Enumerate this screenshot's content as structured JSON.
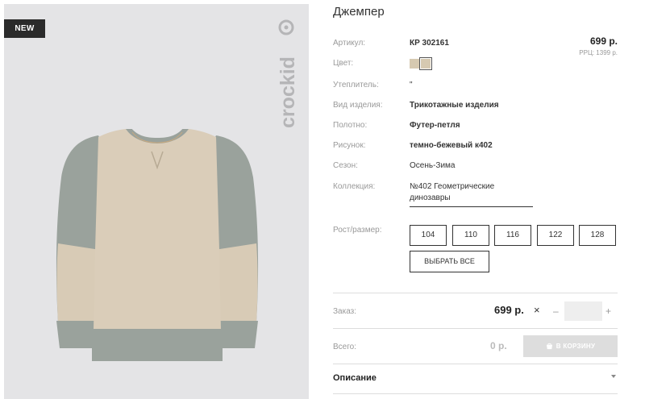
{
  "product": {
    "badge": "NEW",
    "title": "Джемпер",
    "brand": "crockid"
  },
  "specs": {
    "article_label": "Артикул:",
    "article_value": "КР 302161",
    "color_label": "Цвет:",
    "insulation_label": "Утеплитель:",
    "insulation_value": "\"",
    "type_label": "Вид изделия:",
    "type_value": "Трикотажные изделия",
    "fabric_label": "Полотно:",
    "fabric_value": "Футер-петля",
    "pattern_label": "Рисунок:",
    "pattern_value": "темно-бежевый к402",
    "season_label": "Сезон:",
    "season_value": "Осень-Зима",
    "collection_label": "Коллекция:",
    "collection_value": "№402 Геометрические динозавры",
    "size_label": "Рост/размер:"
  },
  "pricing": {
    "price": "699 р.",
    "rrp": "РРЦ: 1399 р."
  },
  "colors": {
    "swatch_1": "#d6c9b1",
    "swatch_2": "#d6c9b1"
  },
  "sizes": [
    "104",
    "110",
    "116",
    "122",
    "128"
  ],
  "select_all_label": "ВЫБРАТЬ ВСЕ",
  "order": {
    "label": "Заказ:",
    "price": "699 р.",
    "times": "×",
    "minus": "–",
    "plus": "+"
  },
  "total": {
    "label": "Всего:",
    "value": "0 р."
  },
  "cart_button": "В КОРЗИНУ",
  "description_label": "Описание"
}
